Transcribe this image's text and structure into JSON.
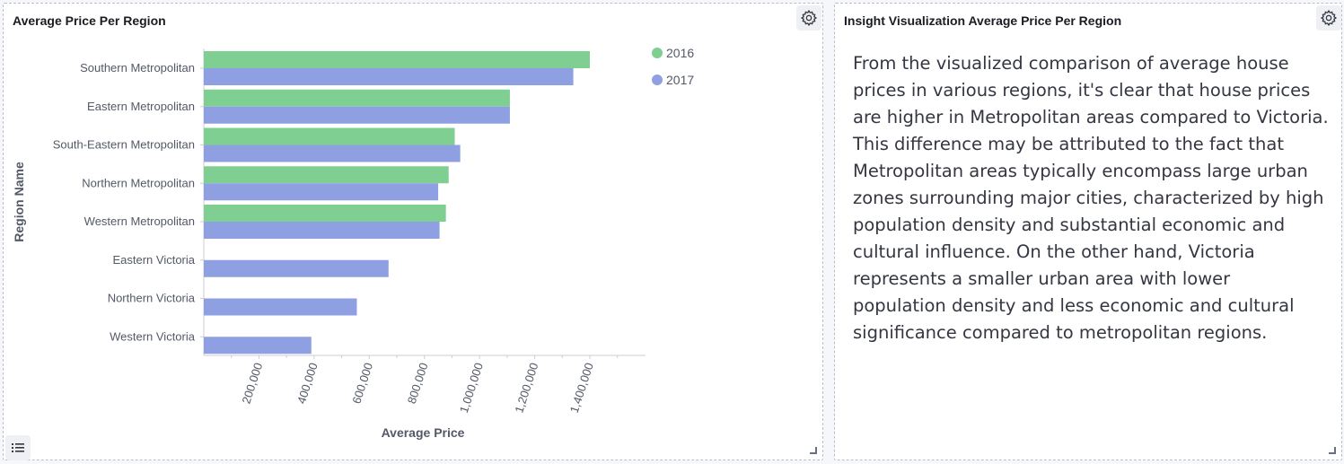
{
  "left_panel": {
    "title": "Average Price Per Region"
  },
  "right_panel": {
    "title": "Insight Visualization Average Price Per Region",
    "text": "From the visualized comparison of average house prices in various regions, it's clear that house prices are higher in Metropolitan areas compared to Victoria. This difference may be attributed to the fact that Metropolitan areas typically encompass large urban zones surrounding major cities, characterized by high population density and substantial economic and cultural influence. On the other hand, Victoria represents a smaller urban area with lower population density and less economic and cultural significance compared to metropolitan regions."
  },
  "icons": {
    "settings": "gear-icon",
    "legend": "list-icon",
    "resize": "resize-handle-icon"
  },
  "chart_data": {
    "type": "bar",
    "orientation": "horizontal",
    "categories": [
      "Southern Metropolitan",
      "Eastern Metropolitan",
      "South-Eastern Metropolitan",
      "Northern Metropolitan",
      "Western Metropolitan",
      "Eastern Victoria",
      "Northern Victoria",
      "Western Victoria"
    ],
    "series": [
      {
        "name": "2016",
        "color": "#7fcf93",
        "values": [
          1400000,
          1110000,
          910000,
          888000,
          878000,
          null,
          null,
          null
        ]
      },
      {
        "name": "2017",
        "color": "#8fa0e2",
        "values": [
          1340000,
          1110000,
          930000,
          850000,
          855000,
          670000,
          555000,
          390000
        ]
      }
    ],
    "xlabel": "Average Price",
    "ylabel": "Region Name",
    "xlim": [
      0,
      1600000
    ],
    "xticks": [
      200000,
      400000,
      600000,
      800000,
      1000000,
      1200000,
      1400000
    ],
    "xtick_labels": [
      "200,000",
      "400,000",
      "600,000",
      "800,000",
      "1,000,000",
      "1,200,000",
      "1,400,000"
    ],
    "legend_position": "top-right",
    "grid": false
  }
}
